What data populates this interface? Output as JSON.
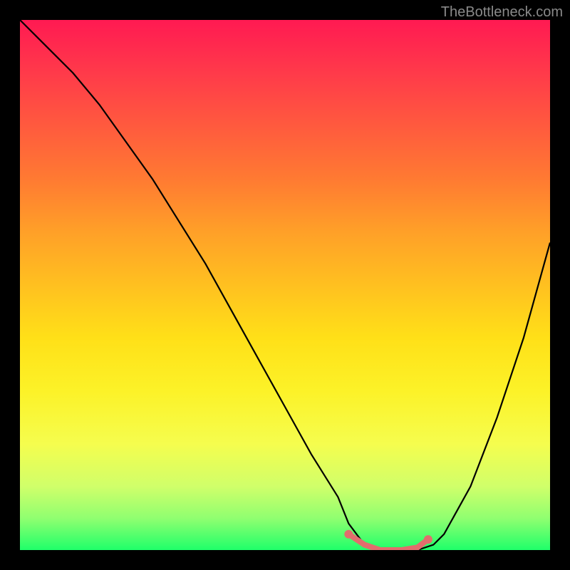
{
  "watermark": "TheBottleneck.com",
  "chart_data": {
    "type": "line",
    "title": "",
    "xlabel": "",
    "ylabel": "",
    "xlim": [
      0,
      100
    ],
    "ylim": [
      0,
      100
    ],
    "series": [
      {
        "name": "bottleneck-curve",
        "x": [
          0,
          5,
          10,
          15,
          20,
          25,
          30,
          35,
          40,
          45,
          50,
          55,
          60,
          62,
          65,
          68,
          72,
          75,
          78,
          80,
          85,
          90,
          95,
          100
        ],
        "values": [
          100,
          95,
          90,
          84,
          77,
          70,
          62,
          54,
          45,
          36,
          27,
          18,
          10,
          5,
          1,
          0,
          0,
          0,
          1,
          3,
          12,
          25,
          40,
          58
        ]
      }
    ],
    "highlight_segment": {
      "name": "optimal-band",
      "x": [
        62,
        65,
        68,
        72,
        75,
        77
      ],
      "values": [
        3,
        1,
        0,
        0,
        0.5,
        2
      ],
      "color": "#e26d6d"
    },
    "highlight_dots": {
      "points": [
        [
          62,
          3
        ],
        [
          77,
          2
        ]
      ],
      "color": "#e26d6d"
    },
    "background": {
      "gradient_stops": [
        {
          "pos": 0,
          "color": "#ff1a52"
        },
        {
          "pos": 50,
          "color": "#ffc020"
        },
        {
          "pos": 80,
          "color": "#f5fd4e"
        },
        {
          "pos": 100,
          "color": "#1fff6a"
        }
      ],
      "frame": "#000000"
    }
  }
}
